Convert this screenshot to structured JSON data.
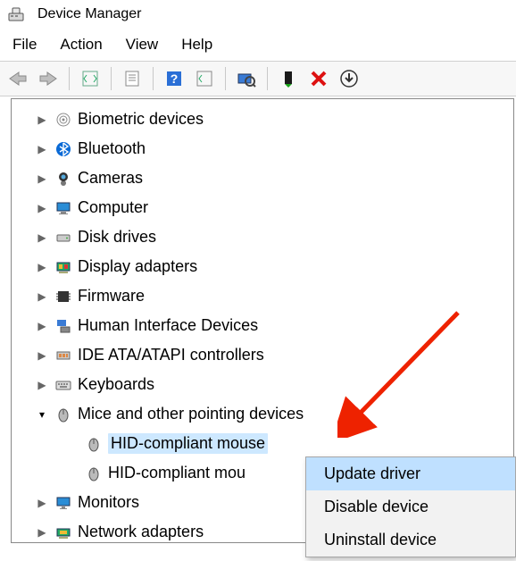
{
  "window": {
    "title": "Device Manager"
  },
  "menu": {
    "file": "File",
    "action": "Action",
    "view": "View",
    "help": "Help"
  },
  "toolbar_icons": {
    "back": "back-arrow-icon",
    "forward": "forward-arrow-icon",
    "show_hidden": "show-hidden-icon",
    "properties_sheet": "properties-sheet-icon",
    "help": "help-icon",
    "action_add": "action-add-icon",
    "scan": "scan-hardware-icon",
    "enable": "enable-device-icon",
    "remove": "remove-device-icon",
    "update": "toolbar-update-icon"
  },
  "tree": {
    "items": [
      {
        "label": "Biometric devices",
        "expanded": false,
        "icon": "fingerprint-icon"
      },
      {
        "label": "Bluetooth",
        "expanded": false,
        "icon": "bluetooth-icon"
      },
      {
        "label": "Cameras",
        "expanded": false,
        "icon": "camera-icon"
      },
      {
        "label": "Computer",
        "expanded": false,
        "icon": "computer-icon"
      },
      {
        "label": "Disk drives",
        "expanded": false,
        "icon": "disk-icon"
      },
      {
        "label": "Display adapters",
        "expanded": false,
        "icon": "display-adapter-icon"
      },
      {
        "label": "Firmware",
        "expanded": false,
        "icon": "firmware-icon"
      },
      {
        "label": "Human Interface Devices",
        "expanded": false,
        "icon": "hid-icon"
      },
      {
        "label": "IDE ATA/ATAPI controllers",
        "expanded": false,
        "icon": "ide-icon"
      },
      {
        "label": "Keyboards",
        "expanded": false,
        "icon": "keyboard-icon"
      },
      {
        "label": "Mice and other pointing devices",
        "expanded": true,
        "icon": "mouse-category-icon",
        "children": [
          {
            "label": "HID-compliant mouse",
            "icon": "mouse-icon",
            "selected": true
          },
          {
            "label": "HID-compliant mouse",
            "icon": "mouse-icon",
            "clipped": "HID-compliant mou"
          }
        ]
      },
      {
        "label": "Monitors",
        "expanded": false,
        "icon": "monitor-icon"
      },
      {
        "label": "Network adapters",
        "expanded": false,
        "icon": "network-icon"
      }
    ]
  },
  "context_menu": {
    "items": [
      {
        "label": "Update driver",
        "highlighted": true
      },
      {
        "label": "Disable device",
        "highlighted": false
      },
      {
        "label": "Uninstall device",
        "highlighted": false
      }
    ]
  }
}
